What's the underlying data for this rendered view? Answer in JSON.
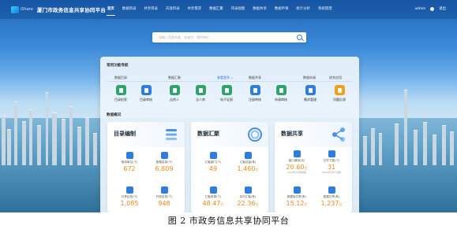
{
  "header": {
    "brand": "iShare",
    "title": "厦门市政务信息共享协同平台",
    "nav": [
      "首页",
      "数据目录",
      "共享目录",
      "开放目录",
      "共享需求",
      "数据汇聚",
      "目录视图",
      "数据共享",
      "数据申请",
      "统计分析",
      "系统管理"
    ],
    "user": "admin",
    "logout": "退出"
  },
  "search": {
    "placeholder": "请输入资源名称、关键字、提供单位"
  },
  "functions": {
    "title": "常用功能导航",
    "groups": [
      {
        "label": "数据目录"
      },
      {
        "label": "数据汇聚",
        "more": "查看更多 ⌄"
      },
      {
        "label": "数据共享"
      },
      {
        "label": "数据申请"
      },
      {
        "label": "综合应用"
      }
    ],
    "items": [
      {
        "label": "目录检索",
        "color": "#2fa36b"
      },
      {
        "label": "目录审核",
        "color": "#2f7de1"
      },
      {
        "label": "自然人",
        "color": "#2fa36b"
      },
      {
        "label": "法人库",
        "color": "#2fa36b"
      },
      {
        "label": "电子证照",
        "color": "#2fa36b"
      },
      {
        "label": "注册审核",
        "color": "#2f7de1"
      },
      {
        "label": "申请审核",
        "color": "#2fa36b"
      },
      {
        "label": "需求管理",
        "color": "#2f7de1"
      },
      {
        "label": "问题反馈",
        "color": "#f0a020"
      }
    ]
  },
  "overview": {
    "title": "数据概况",
    "cards": [
      {
        "title": "目录编制",
        "stats": [
          {
            "label": "使用单位(个)",
            "value": "672",
            "unit": "",
            "sub": ""
          },
          {
            "label": "数据目录(个)",
            "value": "6,809",
            "unit": "",
            "sub": ""
          },
          {
            "label": "共享目录(个)",
            "value": "1,085",
            "unit": "",
            "sub": ""
          },
          {
            "label": "开放目录(个)",
            "value": "948",
            "unit": "",
            "sub": ""
          }
        ]
      },
      {
        "title": "数据汇聚",
        "stats": [
          {
            "label": "汇聚部门(个)",
            "value": "49",
            "unit": "",
            "sub": ""
          },
          {
            "label": "汇聚总量(条)",
            "value": "1,460",
            "unit": "亿",
            "sub": ""
          },
          {
            "label": "汇聚资源(个)",
            "value": "48.47",
            "unit": "万",
            "sub": ""
          },
          {
            "label": "实时汇聚(条)",
            "value": "22.36",
            "unit": "亿",
            "sub": ""
          }
        ]
      },
      {
        "title": "数据共享",
        "stats": [
          {
            "label": "接口调用(次)",
            "value": "20.60",
            "unit": "亿",
            "sub": "2021年日均调用量"
          },
          {
            "label": "文件下载(个)",
            "value": "31",
            "unit": "",
            "sub": "2021年日均下载量"
          },
          {
            "label": "数据库共享(条)",
            "value": "15.12",
            "unit": "亿",
            "sub": ""
          },
          {
            "label": "数据共享(条)",
            "value": "1,237",
            "unit": "亿",
            "sub": ""
          }
        ]
      }
    ]
  },
  "caption": "图 2 市政务信息共享协同平台"
}
